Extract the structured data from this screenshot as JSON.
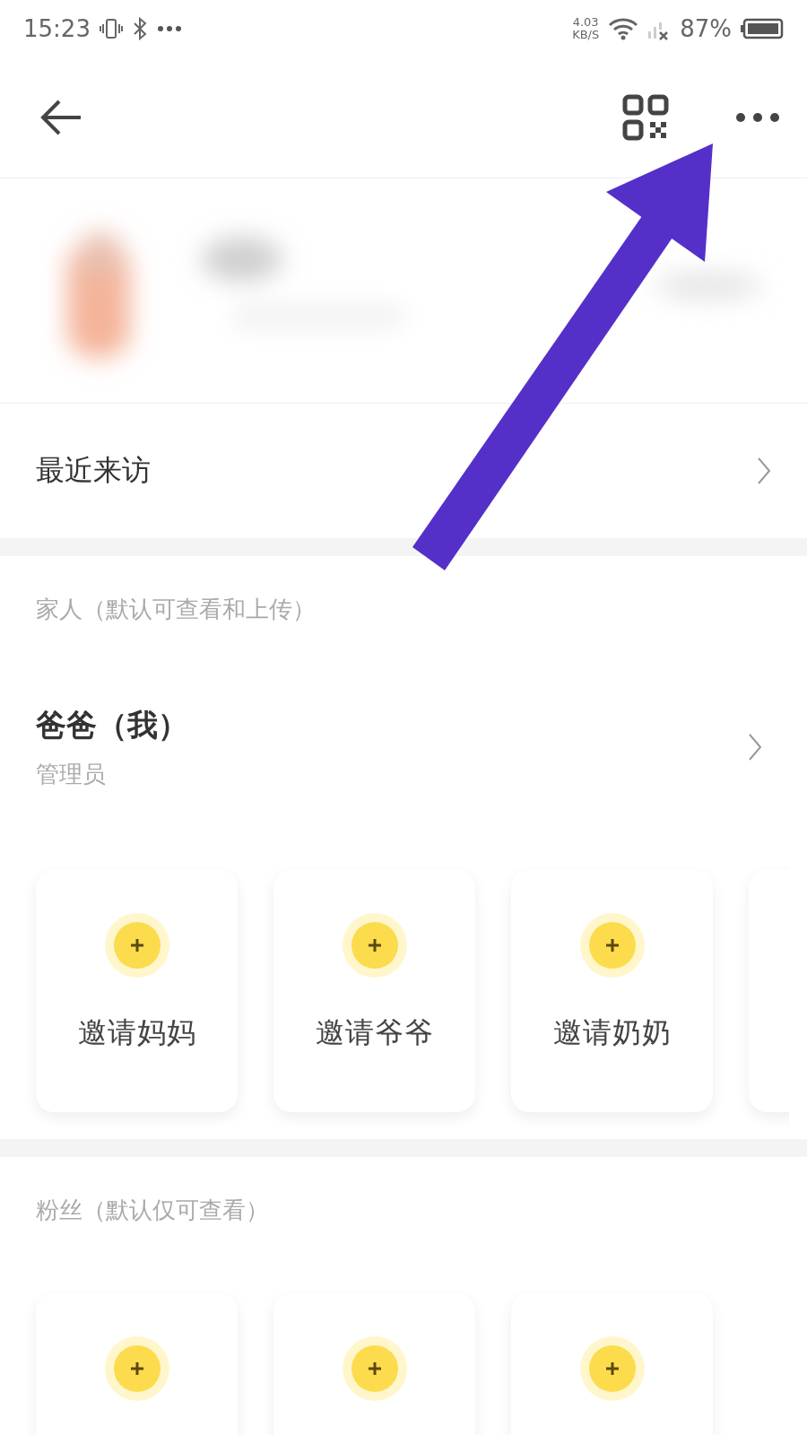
{
  "status_bar": {
    "time": "15:23",
    "net_speed": "4.03",
    "net_unit": "KB/S",
    "battery": "87%"
  },
  "recent": {
    "label": "最近来访"
  },
  "family": {
    "title": "家人（默认可查看和上传）",
    "member": {
      "name": "爸爸（我）",
      "role": "管理员"
    },
    "invites": [
      {
        "kind": "full",
        "label": "邀请妈妈"
      },
      {
        "kind": "full",
        "label": "邀请爷爷"
      },
      {
        "kind": "full",
        "label": "邀请奶奶"
      },
      {
        "kind": "edge"
      }
    ]
  },
  "fans": {
    "title": "粉丝（默认仅可查看）",
    "invites": [
      {
        "kind": "top"
      },
      {
        "kind": "top"
      },
      {
        "kind": "top"
      }
    ]
  }
}
